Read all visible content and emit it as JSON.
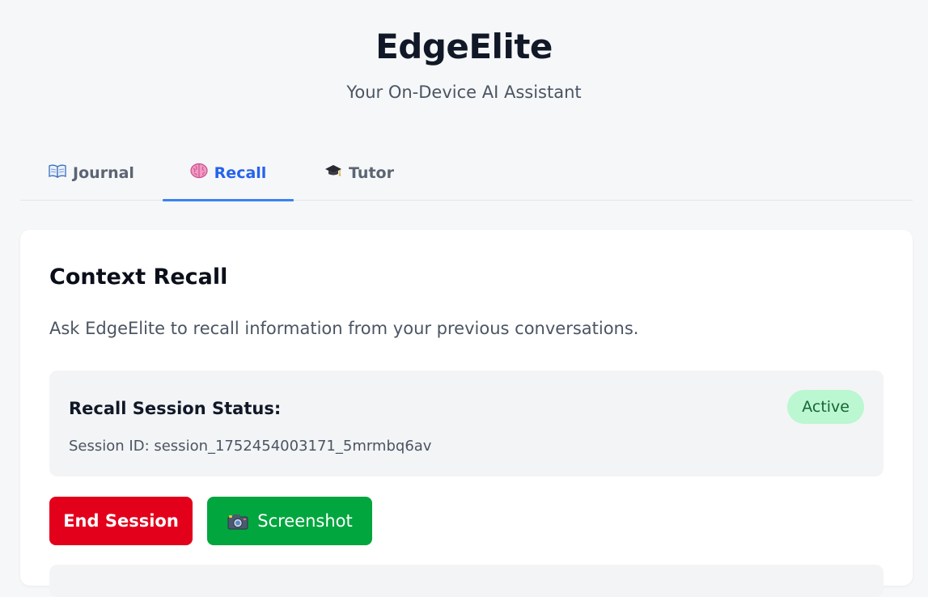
{
  "app": {
    "title": "EdgeElite",
    "subtitle": "Your On-Device AI Assistant"
  },
  "tabs": [
    {
      "label": "Journal",
      "icon": "open-book-icon",
      "active": false
    },
    {
      "label": "Recall",
      "icon": "brain-icon",
      "active": true
    },
    {
      "label": "Tutor",
      "icon": "graduation-cap-icon",
      "active": false
    }
  ],
  "recall": {
    "title": "Context Recall",
    "description": "Ask EdgeElite to recall information from your previous conversations.",
    "status": {
      "label": "Recall Session Status:",
      "badge": "Active",
      "session_id": "Session ID: session_1752454003171_5mrmbq6av"
    },
    "buttons": {
      "end_session": "End Session",
      "screenshot": "Screenshot",
      "screenshot_icon": "camera-icon"
    }
  },
  "colors": {
    "accent": "#2563eb",
    "danger": "#e3001b",
    "success": "#02a63e",
    "badge_bg": "#bbf7d0",
    "badge_text": "#166534"
  }
}
